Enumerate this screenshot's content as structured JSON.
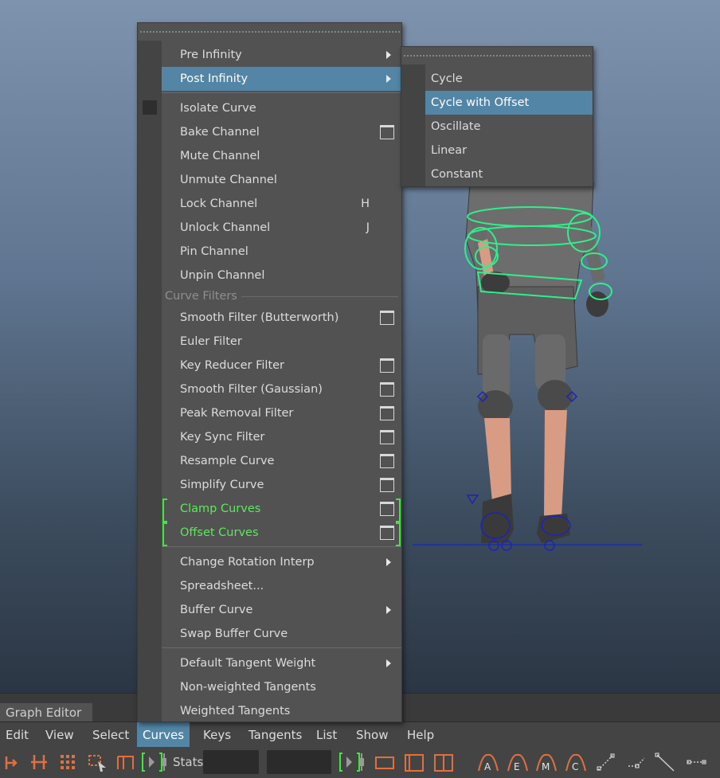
{
  "graph_editor": {
    "title": "Graph Editor",
    "menubar": [
      "Edit",
      "View",
      "Select",
      "Curves",
      "Keys",
      "Tangents",
      "List",
      "Show",
      "Help"
    ],
    "active_menu": "Curves",
    "stats_label": "Stats"
  },
  "curves_menu": {
    "items": [
      {
        "label": "Pre Infinity",
        "submenu": true
      },
      {
        "label": "Post Infinity",
        "submenu": true,
        "highlighted": true
      },
      {
        "label": "Isolate Curve"
      },
      {
        "label": "Bake Channel",
        "option_box": true
      },
      {
        "label": "Mute Channel"
      },
      {
        "label": "Unmute Channel"
      },
      {
        "label": "Lock Channel",
        "shortcut": "H"
      },
      {
        "label": "Unlock Channel",
        "shortcut": "J"
      },
      {
        "label": "Pin Channel"
      },
      {
        "label": "Unpin Channel"
      },
      {
        "section": "Curve Filters"
      },
      {
        "label": "Smooth Filter (Butterworth)",
        "option_box": true
      },
      {
        "label": "Euler Filter"
      },
      {
        "label": "Key Reducer Filter",
        "option_box": true
      },
      {
        "label": "Smooth Filter (Gaussian)",
        "option_box": true
      },
      {
        "label": "Peak Removal Filter",
        "option_box": true
      },
      {
        "label": "Key Sync Filter",
        "option_box": true
      },
      {
        "label": "Resample Curve",
        "option_box": true
      },
      {
        "label": "Simplify Curve",
        "option_box": true
      },
      {
        "label": "Clamp Curves",
        "option_box": true,
        "green": true
      },
      {
        "label": "Offset Curves",
        "option_box": true,
        "green": true
      },
      {
        "label": "Change Rotation Interp",
        "submenu": true
      },
      {
        "label": "Spreadsheet..."
      },
      {
        "label": "Buffer Curve",
        "submenu": true
      },
      {
        "label": "Swap Buffer Curve"
      },
      {
        "label": "Default Tangent Weight",
        "submenu": true
      },
      {
        "label": "Non-weighted Tangents"
      },
      {
        "label": "Weighted Tangents"
      }
    ]
  },
  "post_infinity_submenu": {
    "items": [
      {
        "label": "Cycle"
      },
      {
        "label": "Cycle with Offset",
        "highlighted": true
      },
      {
        "label": "Oscillate"
      },
      {
        "label": "Linear"
      },
      {
        "label": "Constant"
      }
    ]
  },
  "colors": {
    "highlight": "#5285a6",
    "green_text": "#5de85d",
    "menu_bg": "#525252",
    "rig_controls": "#2ef08a",
    "tool_accent": "#e07040"
  },
  "toolbar_icons": [
    "move-key-icon",
    "insert-key-icon",
    "lattice-deform-icon",
    "region-select-icon",
    "retime-tool-icon",
    "frame-selection-icon",
    "frame-playback-icon",
    "normalize-icon",
    "auto-tangent-icon",
    "spline-tangent-icon",
    "clamped-tangent-icon",
    "linear-tangent-icon",
    "stepped-tangent-icon",
    "flat-tangent-icon"
  ]
}
